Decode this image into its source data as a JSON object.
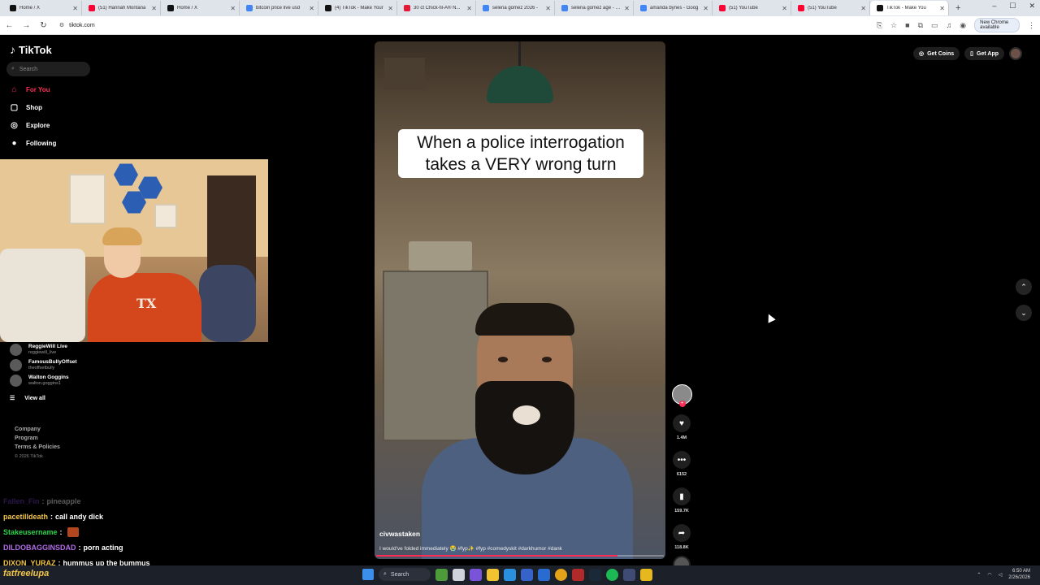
{
  "browser": {
    "tabs": [
      {
        "title": "Home / X",
        "color": "#111111"
      },
      {
        "title": "(51) Hannah Montana",
        "color": "#ff0033"
      },
      {
        "title": "Home / X",
        "color": "#111111"
      },
      {
        "title": "bitcoin price live usd",
        "color": "#4285f4"
      },
      {
        "title": "(4) TikTok - Make Your",
        "color": "#111111"
      },
      {
        "title": "30 ct Chick-fil-A® N...",
        "color": "#e51636"
      },
      {
        "title": "selena gomez 2026 -",
        "color": "#4285f4"
      },
      {
        "title": "selena gomez age - Go",
        "color": "#4285f4"
      },
      {
        "title": "amanda bynes - Goog",
        "color": "#4285f4"
      },
      {
        "title": "(51) YouTube",
        "color": "#ff0033"
      },
      {
        "title": "(51) YouTube",
        "color": "#ff0033"
      },
      {
        "title": "TikTok - Make You",
        "color": "#111111",
        "active": true
      }
    ],
    "new_tab": "+",
    "url": "tiktok.com",
    "update_label": "New Chrome available"
  },
  "tiktok": {
    "logo": "TikTok",
    "search_placeholder": "Search",
    "nav": [
      {
        "label": "For You",
        "icon": "home-icon",
        "active": true
      },
      {
        "label": "Shop",
        "icon": "shop-bag-icon"
      },
      {
        "label": "Explore",
        "icon": "compass-icon"
      },
      {
        "label": "Following",
        "icon": "following-avatar-icon"
      }
    ],
    "following_accounts": [
      {
        "name": "ReggieWill Live",
        "handle": "reggiewill_live"
      },
      {
        "name": "FamousBullyOffset",
        "handle": "theoffsetbully"
      },
      {
        "name": "Walton Goggins",
        "handle": "walton.goggins1"
      }
    ],
    "view_all": "View all",
    "footer_links": [
      "Company",
      "Program",
      "Terms & Policies"
    ],
    "copyright": "© 2026 TikTok",
    "top_buttons": {
      "coins": "Get Coins",
      "app": "Get App"
    },
    "video": {
      "caption_line1": "When a police interrogation",
      "caption_line2": "takes a VERY wrong turn",
      "author": "civwastaken",
      "description": "I would've folded immediately 😭 #fyp✨ #fyp #comedyskit #darkhumor #dank",
      "progress": 0.84
    },
    "actions": {
      "likes": "1.4M",
      "comments": "6152",
      "saves": "159.7K",
      "shares": "118.8K"
    }
  },
  "stream_overlay": {
    "chat": [
      {
        "user": "Fallen_Fin",
        "message": "pineapple",
        "color": "#7b3fd0",
        "faded": true
      },
      {
        "user": "pacetilldeath",
        "message": "call andy dick",
        "color": "#f3c64a"
      },
      {
        "user": "Stakeusername",
        "message": "",
        "color": "#2bd34a",
        "emote": true
      },
      {
        "user": "DILDOBAGGINSDAD",
        "message": "porn acting",
        "color": "#b16be6"
      },
      {
        "user": "DIXON_YURAZ",
        "message": "hummus up the bummus",
        "color": "#f3c64a"
      }
    ],
    "streamer_name": "fatfreelupa"
  },
  "taskbar": {
    "search_label": "Search",
    "time": "6:50 AM",
    "date": "2/26/2026"
  }
}
